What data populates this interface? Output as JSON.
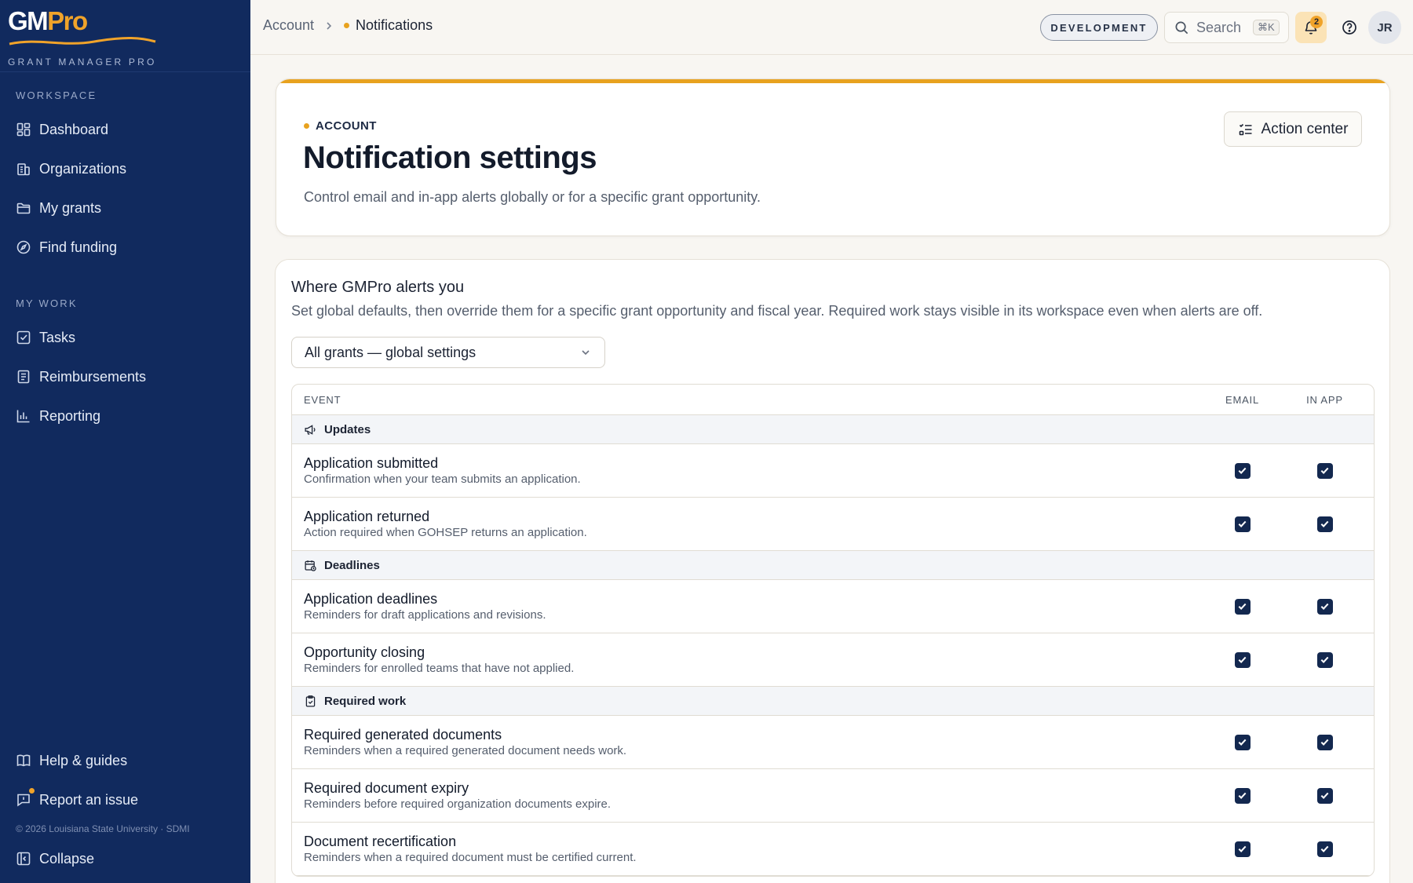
{
  "brand": {
    "logo_gm": "GM",
    "logo_pro": "Pro",
    "subtitle": "GRANT MANAGER PRO"
  },
  "sidebar": {
    "workspace_label": "WORKSPACE",
    "workspace_items": [
      {
        "label": "Dashboard",
        "icon": "grid-icon"
      },
      {
        "label": "Organizations",
        "icon": "building-icon"
      },
      {
        "label": "My grants",
        "icon": "folder-icon"
      },
      {
        "label": "Find funding",
        "icon": "compass-icon"
      }
    ],
    "mywork_label": "MY WORK",
    "mywork_items": [
      {
        "label": "Tasks",
        "icon": "checkbox-icon"
      },
      {
        "label": "Reimbursements",
        "icon": "receipt-icon"
      },
      {
        "label": "Reporting",
        "icon": "bar-chart-icon"
      }
    ],
    "help_label": "Help & guides",
    "report_label": "Report an issue",
    "footer_text": "© 2026 Louisiana State University · SDMI",
    "collapse_label": "Collapse"
  },
  "topbar": {
    "breadcrumb_parent": "Account",
    "breadcrumb_current": "Notifications",
    "env_badge": "DEVELOPMENT",
    "search_label": "Search",
    "search_shortcut": "⌘K",
    "notification_count": "2",
    "avatar_initials": "JR",
    "accent_color": "#e8a21f"
  },
  "hero": {
    "eyebrow": "ACCOUNT",
    "title": "Notification settings",
    "subtitle": "Control email and in-app alerts globally or for a specific grant opportunity.",
    "action_label": "Action center"
  },
  "settings": {
    "title": "Where GMPro alerts you",
    "subtitle": "Set global defaults, then override them for a specific grant opportunity and fiscal year. Required work stays visible in its workspace even when alerts are off.",
    "scope_selected": "All grants — global settings",
    "columns": {
      "event": "EVENT",
      "email": "EMAIL",
      "in_app": "IN APP"
    },
    "groups": [
      {
        "name": "Updates",
        "icon": "megaphone-icon",
        "events": [
          {
            "title": "Application submitted",
            "description": "Confirmation when your team submits an application.",
            "email": true,
            "in_app": true
          },
          {
            "title": "Application returned",
            "description": "Action required when GOHSEP returns an application.",
            "email": true,
            "in_app": true
          }
        ]
      },
      {
        "name": "Deadlines",
        "icon": "calendar-clock-icon",
        "events": [
          {
            "title": "Application deadlines",
            "description": "Reminders for draft applications and revisions.",
            "email": true,
            "in_app": true
          },
          {
            "title": "Opportunity closing",
            "description": "Reminders for enrolled teams that have not applied.",
            "email": true,
            "in_app": true
          }
        ]
      },
      {
        "name": "Required work",
        "icon": "clipboard-check-icon",
        "events": [
          {
            "title": "Required generated documents",
            "description": "Reminders when a required generated document needs work.",
            "email": true,
            "in_app": true
          },
          {
            "title": "Required document expiry",
            "description": "Reminders before required organization documents expire.",
            "email": true,
            "in_app": true
          },
          {
            "title": "Document recertification",
            "description": "Reminders when a required document must be certified current.",
            "email": true,
            "in_app": true
          }
        ]
      }
    ]
  }
}
